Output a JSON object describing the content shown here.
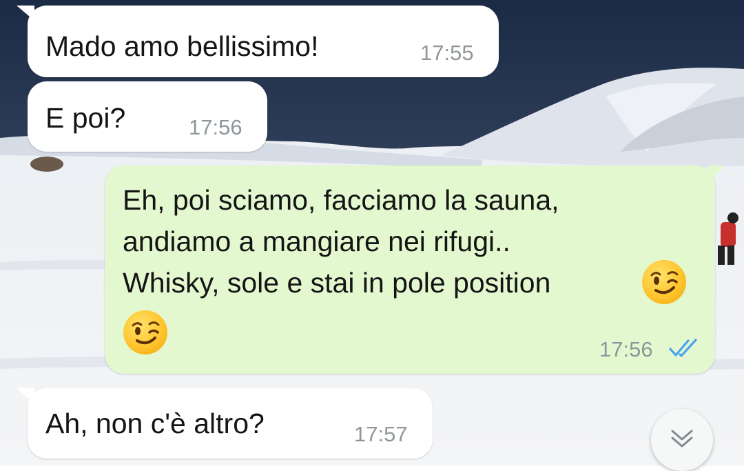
{
  "chat": {
    "messages": [
      {
        "direction": "incoming",
        "text": "Mado amo bellissimo!",
        "time": "17:55"
      },
      {
        "direction": "incoming",
        "text": "E poi?",
        "time": "17:56"
      },
      {
        "direction": "outgoing",
        "lines": [
          "Eh, poi sciamo, facciamo la sauna,",
          "andiamo a mangiare nei rifugi..",
          "Whisky, sole e stai in pole position"
        ],
        "emoji": "winking-face",
        "time": "17:56",
        "status": "read"
      },
      {
        "direction": "incoming",
        "text": "Ah, non c'è altro?",
        "time": "17:57"
      }
    ]
  },
  "colors": {
    "incoming_bubble": "#ffffff",
    "outgoing_bubble": "#e4f8d0",
    "timestamp": "#8e9699",
    "read_ticks": "#4aa3f0"
  },
  "icons": {
    "scroll_down": "double-chevron-down-icon",
    "read_receipt": "double-check-icon",
    "emoji": "winking-face-emoji"
  }
}
